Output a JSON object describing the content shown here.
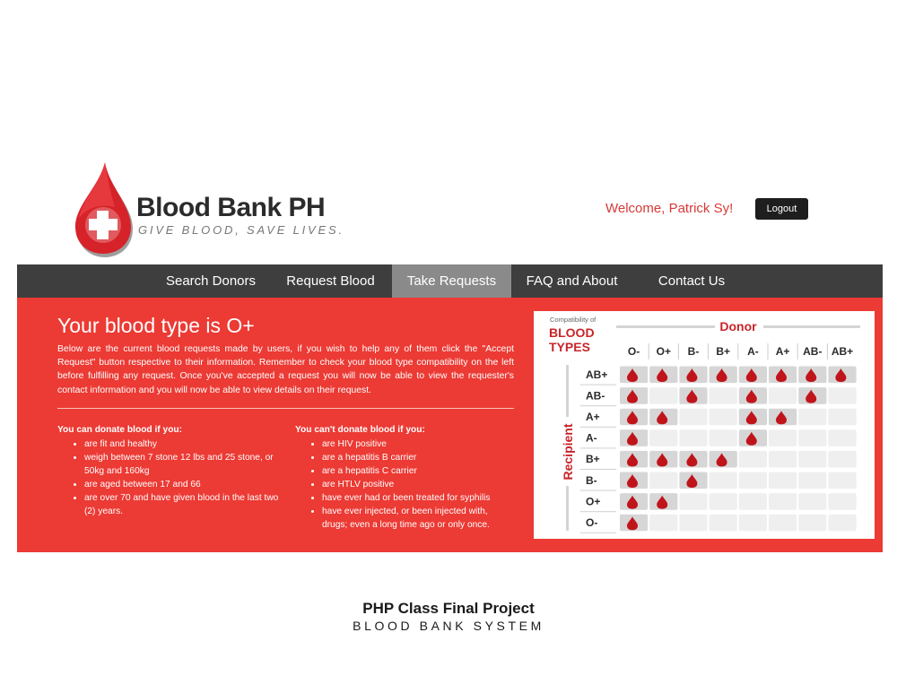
{
  "header": {
    "logo_title": "Blood Bank PH",
    "logo_tagline": "GIVE BLOOD, SAVE LIVES.",
    "welcome": "Welcome, Patrick Sy!",
    "logout_label": "Logout"
  },
  "nav": {
    "items": [
      {
        "label": "Search Donors"
      },
      {
        "label": "Request Blood"
      },
      {
        "label": "Take Requests"
      },
      {
        "label": "FAQ and About"
      },
      {
        "label": "Contact Us"
      }
    ],
    "active_index": 2
  },
  "main": {
    "heading": "Your blood type is O+",
    "intro": "Below are the current blood requests made by users, if you wish to help any of them click the \"Accept Request\" button respective to their information. Remember to check your blood type compatibility on the left before fulfilling any request. Once you've accepted a request you will now be able to view the requester's contact information and you will now be able to view details on their request.",
    "can_donate": {
      "title": "You can donate blood if you:",
      "items": [
        "are fit and healthy",
        "weigh between 7 stone 12 lbs and 25 stone, or 50kg and 160kg",
        "are aged between 17 and 66",
        "are over 70 and have given blood in the last two (2) years."
      ]
    },
    "cant_donate": {
      "title": "You can't donate blood if you:",
      "items": [
        "are HIV positive",
        "are a hepatitis B carrier",
        "are a hepatitis C carrier",
        "are HTLV positive",
        "have ever had or been treated for syphilis",
        "have ever injected, or been injected with, drugs; even a long time ago or only once."
      ]
    }
  },
  "compat_chart": {
    "caption": "Compatibility of",
    "title_line1": "BLOOD",
    "title_line2": "TYPES",
    "donor_label": "Donor",
    "recipient_label": "Recipient",
    "donor_types": [
      "O-",
      "O+",
      "B-",
      "B+",
      "A-",
      "A+",
      "AB-",
      "AB+"
    ],
    "recipient_types": [
      "AB+",
      "AB-",
      "A+",
      "A-",
      "B+",
      "B-",
      "O+",
      "O-"
    ],
    "matrix": [
      [
        1,
        1,
        1,
        1,
        1,
        1,
        1,
        1
      ],
      [
        1,
        0,
        1,
        0,
        1,
        0,
        1,
        0
      ],
      [
        1,
        1,
        0,
        0,
        1,
        1,
        0,
        0
      ],
      [
        1,
        0,
        0,
        0,
        1,
        0,
        0,
        0
      ],
      [
        1,
        1,
        1,
        1,
        0,
        0,
        0,
        0
      ],
      [
        1,
        0,
        1,
        0,
        0,
        0,
        0,
        0
      ],
      [
        1,
        1,
        0,
        0,
        0,
        0,
        0,
        0
      ],
      [
        1,
        0,
        0,
        0,
        0,
        0,
        0,
        0
      ]
    ],
    "colors": {
      "drop": "#c0141b",
      "accent": "#c8252a",
      "cell_empty": "#efefef",
      "cell_filled": "#d6d6d6"
    }
  },
  "footer": {
    "title": "PHP Class Final Project",
    "subtitle": "BLOOD BANK SYSTEM"
  }
}
